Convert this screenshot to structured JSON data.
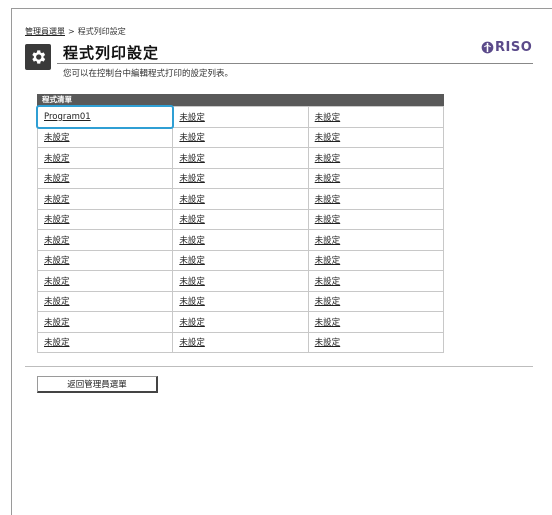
{
  "breadcrumb": {
    "parent": "管理員選單",
    "separator": ">",
    "current": "程式列印設定"
  },
  "header": {
    "title": "程式列印設定",
    "subtitle": "您可以在控制台中編輯程式打印的設定列表。",
    "icon": "gear-icon",
    "brand": "RISO",
    "brand_color": "#5b4a8a"
  },
  "table": {
    "header_label": "程式清單",
    "rows": [
      [
        "Program01",
        "未設定",
        "未設定"
      ],
      [
        "未設定",
        "未設定",
        "未設定"
      ],
      [
        "未設定",
        "未設定",
        "未設定"
      ],
      [
        "未設定",
        "未設定",
        "未設定"
      ],
      [
        "未設定",
        "未設定",
        "未設定"
      ],
      [
        "未設定",
        "未設定",
        "未設定"
      ],
      [
        "未設定",
        "未設定",
        "未設定"
      ],
      [
        "未設定",
        "未設定",
        "未設定"
      ],
      [
        "未設定",
        "未設定",
        "未設定"
      ],
      [
        "未設定",
        "未設定",
        "未設定"
      ],
      [
        "未設定",
        "未設定",
        "未設定"
      ],
      [
        "未設定",
        "未設定",
        "未設定"
      ]
    ],
    "selected_color": "#2f9fd4"
  },
  "footer": {
    "back_label": "返回管理員選單"
  }
}
